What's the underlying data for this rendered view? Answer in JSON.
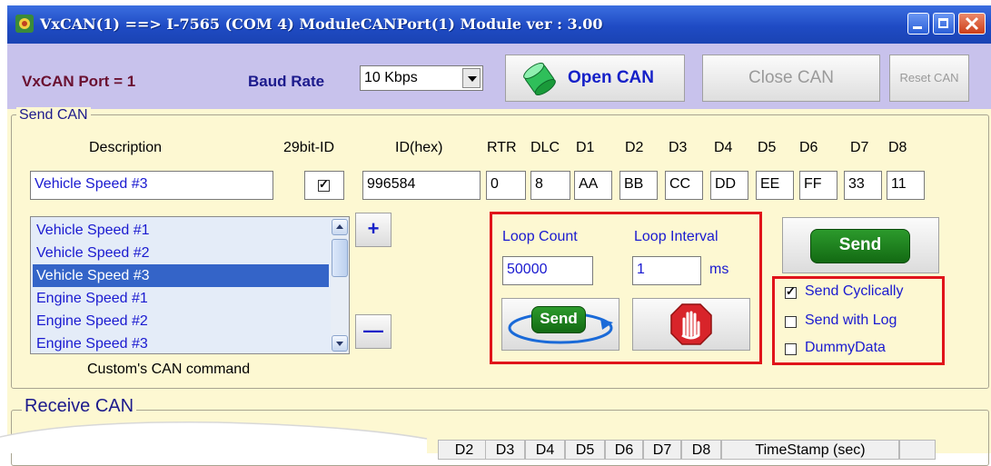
{
  "window": {
    "title": "VxCAN(1) ==> I-7565 (COM 4) ModuleCANPort(1) Module ver : 3.00"
  },
  "topbar": {
    "port_label": "VxCAN Port = 1",
    "baud_label": "Baud Rate",
    "baud_value": "10 Kbps",
    "open_can": "Open CAN",
    "close_can": "Close CAN",
    "reset_can": "Reset CAN"
  },
  "send_can": {
    "legend": "Send CAN",
    "headers": {
      "description": "Description",
      "bit29": "29bit-ID",
      "id_hex": "ID(hex)",
      "rtr": "RTR",
      "dlc": "DLC",
      "d1": "D1",
      "d2": "D2",
      "d3": "D3",
      "d4": "D4",
      "d5": "D5",
      "d6": "D6",
      "d7": "D7",
      "d8": "D8"
    },
    "values": {
      "description": "Vehicle Speed #3",
      "bit29_checked": true,
      "id_hex": "996584",
      "rtr": "0",
      "dlc": "8",
      "d1": "AA",
      "d2": "BB",
      "d3": "CC",
      "d4": "DD",
      "d5": "EE",
      "d6": "FF",
      "d7": "33",
      "d8": "11"
    },
    "commands": [
      "Vehicle Speed #1",
      "Vehicle Speed #2",
      "Vehicle Speed #3",
      "Engine Speed #1",
      "Engine Speed #2",
      "Engine Speed #3"
    ],
    "selected_index": 2,
    "add_label": "+",
    "remove_label": "—",
    "custom_label": "Custom's CAN command",
    "loop": {
      "count_label": "Loop Count",
      "count_value": "50000",
      "interval_label": "Loop Interval",
      "interval_value": "1",
      "interval_unit": "ms",
      "send_label": "Send"
    },
    "send_label": "Send",
    "options": [
      {
        "label": "Send Cyclically",
        "checked": true
      },
      {
        "label": "Send with Log",
        "checked": false
      },
      {
        "label": "DummyData",
        "checked": false
      }
    ]
  },
  "receive_can": {
    "legend": "Receive CAN",
    "columns": [
      "D2",
      "D3",
      "D4",
      "D5",
      "D6",
      "D7",
      "D8",
      "TimeStamp (sec)"
    ]
  },
  "colors": {
    "highlight_red": "#e0141a",
    "title_blue": "#1f4bc4",
    "panel_bg": "#fdf8d2"
  }
}
